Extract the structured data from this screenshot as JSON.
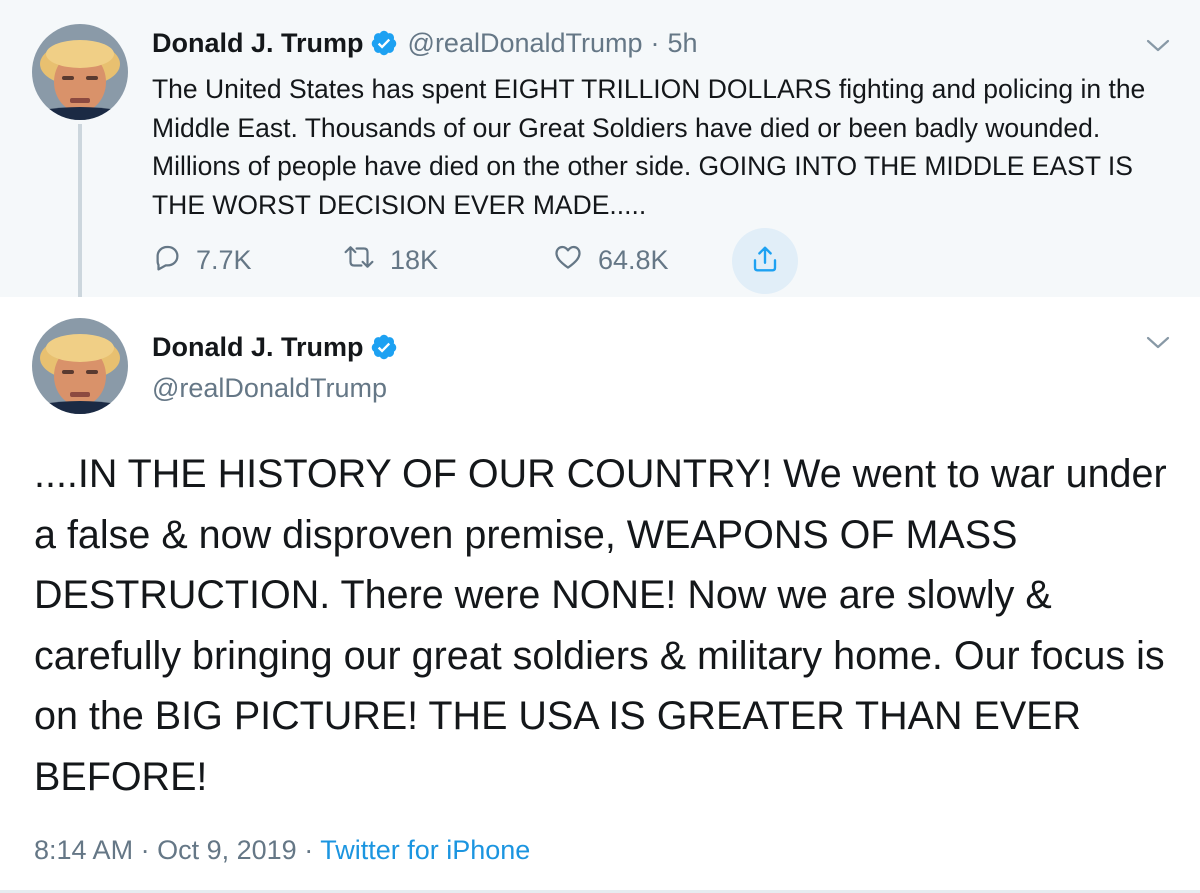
{
  "parent_tweet": {
    "display_name": "Donald J. Trump",
    "handle": "@realDonaldTrump",
    "separator": "·",
    "time": "5h",
    "text": "The United States has spent EIGHT TRILLION DOLLARS fighting and policing in the Middle East. Thousands of our Great Soldiers have died or been badly wounded. Millions of people have died on the other side. GOING INTO THE MIDDLE EAST IS THE WORST DECISION EVER MADE.....",
    "reply_count": "7.7K",
    "retweet_count": "18K",
    "like_count": "64.8K"
  },
  "main_tweet": {
    "display_name": "Donald J. Trump",
    "handle": "@realDonaldTrump",
    "text": "....IN THE HISTORY OF OUR COUNTRY! We went to war under a false & now disproven premise, WEAPONS OF MASS DESTRUCTION. There were NONE! Now we are slowly & carefully bringing our great soldiers & military home. Our focus is on the BIG PICTURE! THE USA IS GREATER THAN EVER BEFORE!",
    "time": "8:14 AM",
    "separator_1": "·",
    "date": "Oct 9, 2019",
    "separator_2": "·",
    "source": "Twitter for iPhone"
  },
  "icons": {
    "verified": "verified-badge-icon",
    "reply": "reply-icon",
    "retweet": "retweet-icon",
    "like": "like-icon",
    "share": "share-icon",
    "more": "chevron-down-icon"
  },
  "colors": {
    "verified_blue": "#1da1f2",
    "link_blue": "#1b95e0",
    "muted_gray": "#657786",
    "parent_background": "#f5f8fa"
  }
}
